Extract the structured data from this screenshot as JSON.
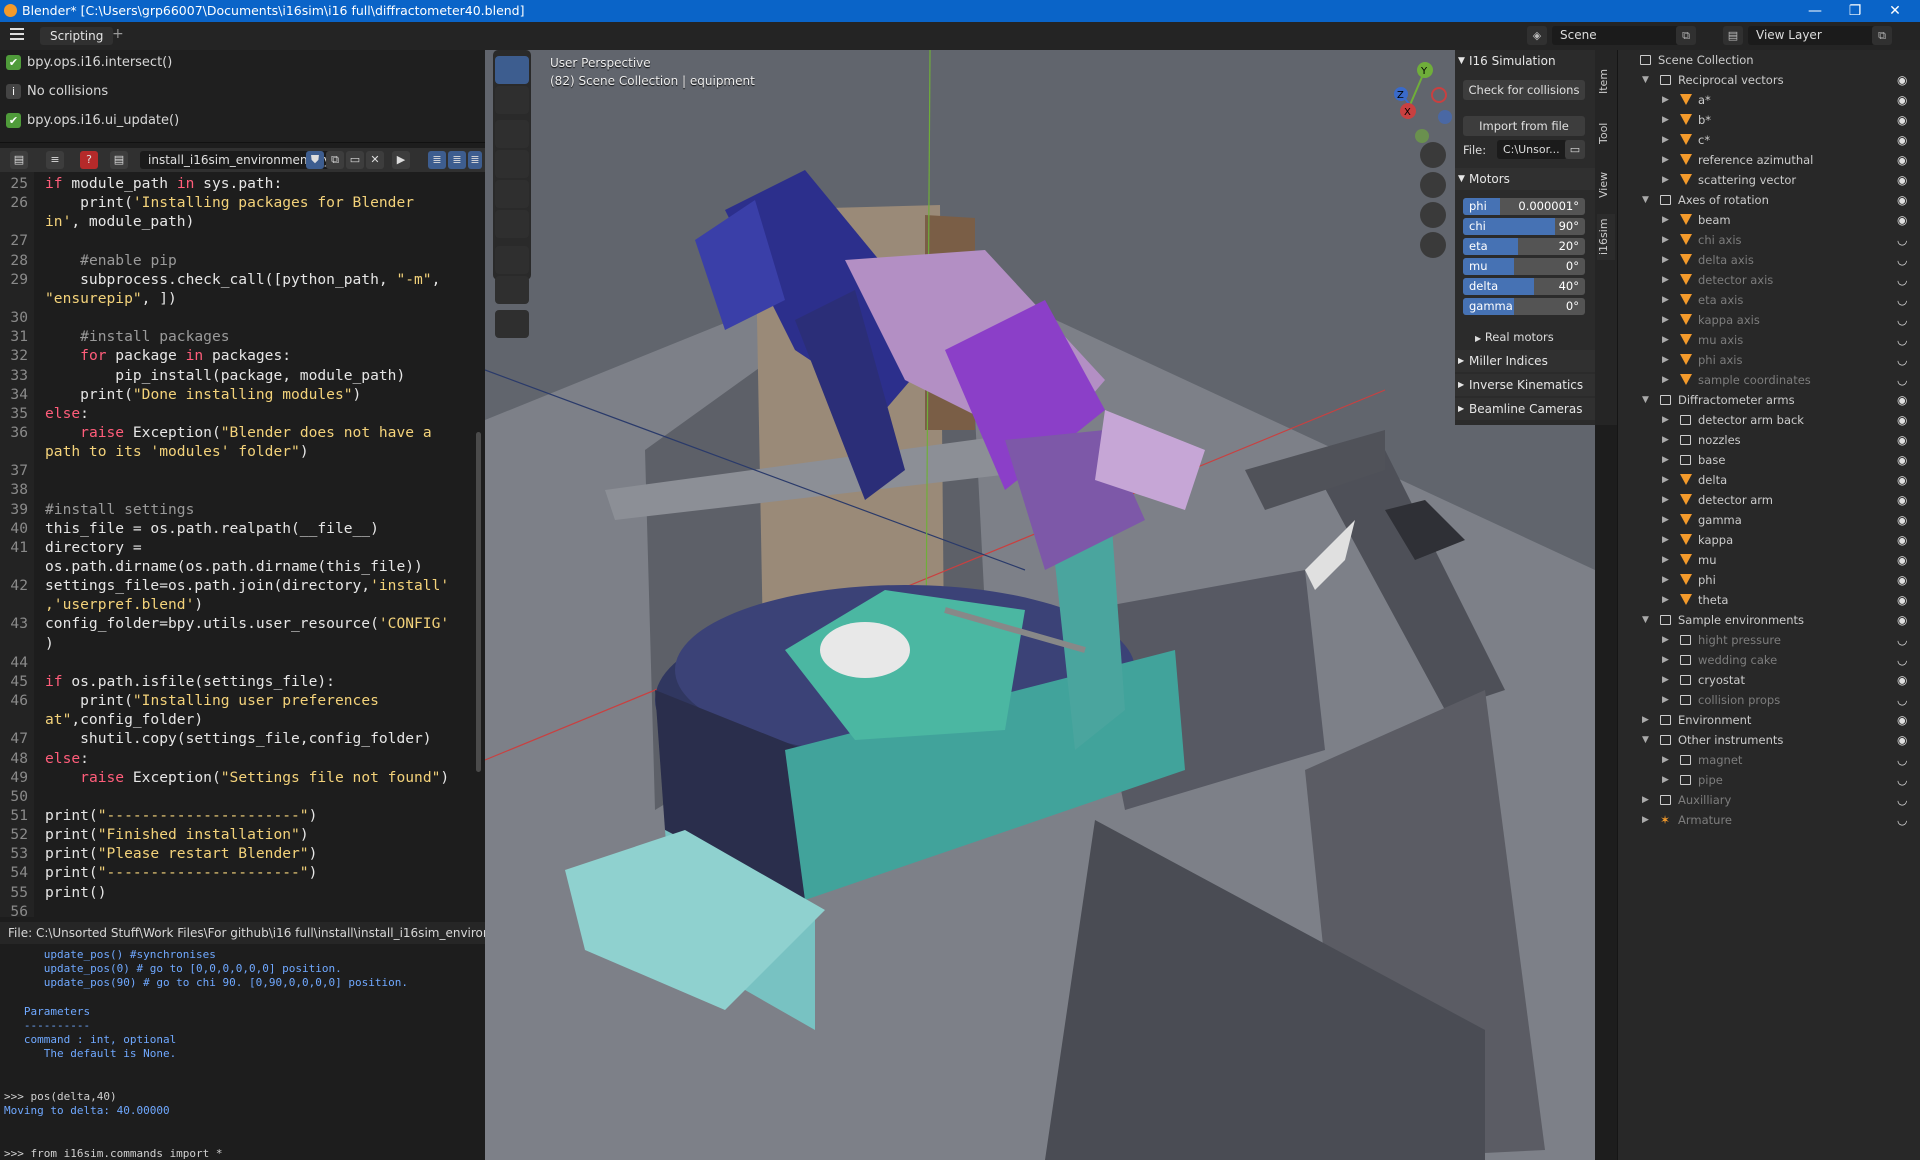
{
  "window": {
    "title": "Blender* [C:\\Users\\grp66007\\Documents\\i16sim\\i16 full\\diffractometer40.blend]",
    "minimize": "—",
    "maximize": "❐",
    "close": "✕"
  },
  "topbar": {
    "workspace_tab": "Scripting",
    "add_tab": "+",
    "scene": "Scene",
    "view_layer": "View Layer"
  },
  "info": [
    {
      "icon": "check",
      "text": "bpy.ops.i16.intersect()"
    },
    {
      "icon": "info",
      "text": "No collisions"
    },
    {
      "icon": "check",
      "text": "bpy.ops.i16.ui_update()"
    }
  ],
  "text_editor": {
    "file_name": "install_i16sim_environment.py",
    "footer": "File: C:\\Unsorted Stuff\\Work Files\\For github\\i16 full\\install\\install_i16sim_environment.py",
    "lines": [
      {
        "n": "25",
        "html": "<span class='kw'>if</span> module_path <span class='kw'>in</span> sys.path:"
      },
      {
        "n": "26",
        "html": "    print(<span class='str'>'Installing packages for Blender</span>"
      },
      {
        "n": "",
        "html": "<span class='str'>in'</span>, module_path)"
      },
      {
        "n": "27",
        "html": ""
      },
      {
        "n": "28",
        "html": "    <span class='cm'>#enable pip</span>"
      },
      {
        "n": "29",
        "html": "    subprocess.check_call([python_path, <span class='str'>\"-m\"</span>,"
      },
      {
        "n": "",
        "html": "<span class='str'>\"ensurepip\"</span>, ])"
      },
      {
        "n": "30",
        "html": ""
      },
      {
        "n": "31",
        "html": "    <span class='cm'>#install packages</span>"
      },
      {
        "n": "32",
        "html": "    <span class='kw'>for</span> package <span class='kw'>in</span> packages:"
      },
      {
        "n": "33",
        "html": "        pip_install(package, module_path)"
      },
      {
        "n": "34",
        "html": "    print(<span class='str'>\"Done installing modules\"</span>)"
      },
      {
        "n": "35",
        "html": "<span class='kw'>else</span>:"
      },
      {
        "n": "36",
        "html": "    <span class='kw'>raise</span> Exception(<span class='str'>\"Blender does not have a</span>"
      },
      {
        "n": "",
        "html": "<span class='str'>path to its 'modules' folder\"</span>)"
      },
      {
        "n": "37",
        "html": ""
      },
      {
        "n": "38",
        "html": ""
      },
      {
        "n": "39",
        "html": "<span class='cm'>#install settings</span>"
      },
      {
        "n": "40",
        "html": "this_file = os.path.realpath(__file__)"
      },
      {
        "n": "41",
        "html": "directory ="
      },
      {
        "n": "",
        "html": "os.path.dirname(os.path.dirname(this_file))"
      },
      {
        "n": "42",
        "html": "settings_file=os.path.join(directory,<span class='str'>'install'</span>"
      },
      {
        "n": "",
        "html": "<span class='str'>,'userpref.blend'</span>)"
      },
      {
        "n": "43",
        "html": "config_folder=bpy.utils.user_resource(<span class='str'>'CONFIG'</span>"
      },
      {
        "n": "",
        "html": ")"
      },
      {
        "n": "44",
        "html": ""
      },
      {
        "n": "45",
        "html": "<span class='kw'>if</span> os.path.isfile(settings_file):"
      },
      {
        "n": "46",
        "html": "    print(<span class='str'>\"Installing user preferences</span>"
      },
      {
        "n": "",
        "html": "<span class='str'>at\"</span>,config_folder)"
      },
      {
        "n": "47",
        "html": "    shutil.copy(settings_file,config_folder)"
      },
      {
        "n": "48",
        "html": "<span class='kw'>else</span>:"
      },
      {
        "n": "49",
        "html": "    <span class='kw'>raise</span> Exception(<span class='str'>\"Settings file not found\"</span>)"
      },
      {
        "n": "50",
        "html": ""
      },
      {
        "n": "51",
        "html": "print(<span class='str'>\"----------------------\"</span>)"
      },
      {
        "n": "52",
        "html": "print(<span class='str'>\"Finished installation\"</span>)"
      },
      {
        "n": "53",
        "html": "print(<span class='str'>\"Please restart Blender\"</span>)"
      },
      {
        "n": "54",
        "html": "print(<span class='str'>\"----------------------\"</span>)"
      },
      {
        "n": "55",
        "html": "print()"
      },
      {
        "n": "56",
        "html": ""
      }
    ]
  },
  "console": [
    {
      "c": "b",
      "t": "      update_pos() #synchronises"
    },
    {
      "c": "b",
      "t": "      update_pos(0) # go to [0,0,0,0,0,0] position."
    },
    {
      "c": "b",
      "t": "      update_pos(90) # go to chi 90. [0,90,0,0,0,0] position."
    },
    {
      "c": "b",
      "t": ""
    },
    {
      "c": "b",
      "t": "   Parameters"
    },
    {
      "c": "b",
      "t": "   ----------"
    },
    {
      "c": "b",
      "t": "   command : int, optional"
    },
    {
      "c": "b",
      "t": "      The default is None."
    },
    {
      "c": "b",
      "t": ""
    },
    {
      "c": "b",
      "t": ""
    },
    {
      "c": "w",
      "t": ">>> pos(delta,40)"
    },
    {
      "c": "b",
      "t": "Moving to delta: 40.00000"
    },
    {
      "c": "b",
      "t": ""
    },
    {
      "c": "w",
      "t": ""
    },
    {
      "c": "w",
      "t": ">>> from i16sim.commands import *"
    }
  ],
  "viewport": {
    "perspective": "User Perspective",
    "collection": "(82) Scene Collection | equipment",
    "gizmo": {
      "x": "X",
      "y": "Y",
      "z": "Z"
    }
  },
  "npanel": {
    "header": "I16 Simulation",
    "check_button": "Check for collisions",
    "import_button": "Import from file",
    "file_label": "File:",
    "file_value": "C:\\Unsor...",
    "motors_header": "Motors",
    "motors": [
      {
        "name": "phi",
        "value": "0.000001°",
        "fill": 0.3
      },
      {
        "name": "chi",
        "value": "90°",
        "fill": 0.75
      },
      {
        "name": "eta",
        "value": "20°",
        "fill": 0.45
      },
      {
        "name": "mu",
        "value": "0°",
        "fill": 0.42
      },
      {
        "name": "delta",
        "value": "40°",
        "fill": 0.58
      },
      {
        "name": "gamma",
        "value": "0°",
        "fill": 0.42
      }
    ],
    "real_motors": "Real motors",
    "subpanels": [
      "Miller Indices",
      "Inverse Kinematics",
      "Beamline Cameras"
    ]
  },
  "sidetabs": [
    "Item",
    "Tool",
    "View",
    "i16sim"
  ],
  "outliner": {
    "rows": [
      {
        "d": 0,
        "t": "root",
        "name": "Scene Collection",
        "open": null,
        "dim": false
      },
      {
        "d": 1,
        "t": "coll",
        "name": "Reciprocal vectors",
        "open": true,
        "dim": false
      },
      {
        "d": 2,
        "t": "obj",
        "name": "a*",
        "open": false,
        "dim": false
      },
      {
        "d": 2,
        "t": "obj",
        "name": "b*",
        "open": false,
        "dim": false
      },
      {
        "d": 2,
        "t": "obj",
        "name": "c*",
        "open": false,
        "dim": false
      },
      {
        "d": 2,
        "t": "obj",
        "name": "reference azimuthal",
        "open": false,
        "dim": false
      },
      {
        "d": 2,
        "t": "obj",
        "name": "scattering vector",
        "open": false,
        "dim": false
      },
      {
        "d": 1,
        "t": "coll",
        "name": "Axes of rotation",
        "open": true,
        "dim": false
      },
      {
        "d": 2,
        "t": "obj",
        "name": "beam",
        "open": false,
        "dim": false
      },
      {
        "d": 2,
        "t": "obj",
        "name": "chi axis",
        "open": false,
        "dim": true
      },
      {
        "d": 2,
        "t": "obj",
        "name": "delta axis",
        "open": false,
        "dim": true
      },
      {
        "d": 2,
        "t": "obj",
        "name": "detector axis",
        "open": false,
        "dim": true
      },
      {
        "d": 2,
        "t": "obj",
        "name": "eta axis",
        "open": false,
        "dim": true
      },
      {
        "d": 2,
        "t": "obj",
        "name": "kappa axis",
        "open": false,
        "dim": true
      },
      {
        "d": 2,
        "t": "obj",
        "name": "mu axis",
        "open": false,
        "dim": true
      },
      {
        "d": 2,
        "t": "obj",
        "name": "phi axis",
        "open": false,
        "dim": true
      },
      {
        "d": 2,
        "t": "obj",
        "name": "sample coordinates",
        "open": false,
        "dim": true
      },
      {
        "d": 1,
        "t": "coll",
        "name": "Diffractometer arms",
        "open": true,
        "dim": false
      },
      {
        "d": 2,
        "t": "coll",
        "name": "detector arm back",
        "open": false,
        "dim": false
      },
      {
        "d": 2,
        "t": "coll",
        "name": "nozzles",
        "open": false,
        "dim": false
      },
      {
        "d": 2,
        "t": "coll",
        "name": "base",
        "open": false,
        "dim": false
      },
      {
        "d": 2,
        "t": "obj",
        "name": "delta",
        "open": false,
        "dim": false
      },
      {
        "d": 2,
        "t": "obj",
        "name": "detector arm",
        "open": false,
        "dim": false
      },
      {
        "d": 2,
        "t": "obj",
        "name": "gamma",
        "open": false,
        "dim": false
      },
      {
        "d": 2,
        "t": "obj",
        "name": "kappa",
        "open": false,
        "dim": false
      },
      {
        "d": 2,
        "t": "obj",
        "name": "mu",
        "open": false,
        "dim": false
      },
      {
        "d": 2,
        "t": "obj",
        "name": "phi",
        "open": false,
        "dim": false
      },
      {
        "d": 2,
        "t": "obj",
        "name": "theta",
        "open": false,
        "dim": false
      },
      {
        "d": 1,
        "t": "coll",
        "name": "Sample environments",
        "open": true,
        "dim": false
      },
      {
        "d": 2,
        "t": "coll",
        "name": "hight pressure",
        "open": false,
        "dim": true
      },
      {
        "d": 2,
        "t": "coll",
        "name": "wedding cake",
        "open": false,
        "dim": true
      },
      {
        "d": 2,
        "t": "coll",
        "name": "cryostat",
        "open": false,
        "dim": false
      },
      {
        "d": 2,
        "t": "coll",
        "name": "collision props",
        "open": false,
        "dim": true
      },
      {
        "d": 1,
        "t": "coll",
        "name": "Environment",
        "open": false,
        "dim": false
      },
      {
        "d": 1,
        "t": "coll",
        "name": "Other instruments",
        "open": true,
        "dim": false
      },
      {
        "d": 2,
        "t": "coll",
        "name": "magnet",
        "open": false,
        "dim": true
      },
      {
        "d": 2,
        "t": "coll",
        "name": "pipe",
        "open": false,
        "dim": true
      },
      {
        "d": 1,
        "t": "coll",
        "name": "Auxilliary",
        "open": false,
        "dim": true
      },
      {
        "d": 1,
        "t": "arm",
        "name": "Armature",
        "open": false,
        "dim": true
      }
    ]
  },
  "colors": {
    "accent": "#4672b4",
    "object_orange": "#f39a2b",
    "titlebar": "#0a64c8"
  }
}
